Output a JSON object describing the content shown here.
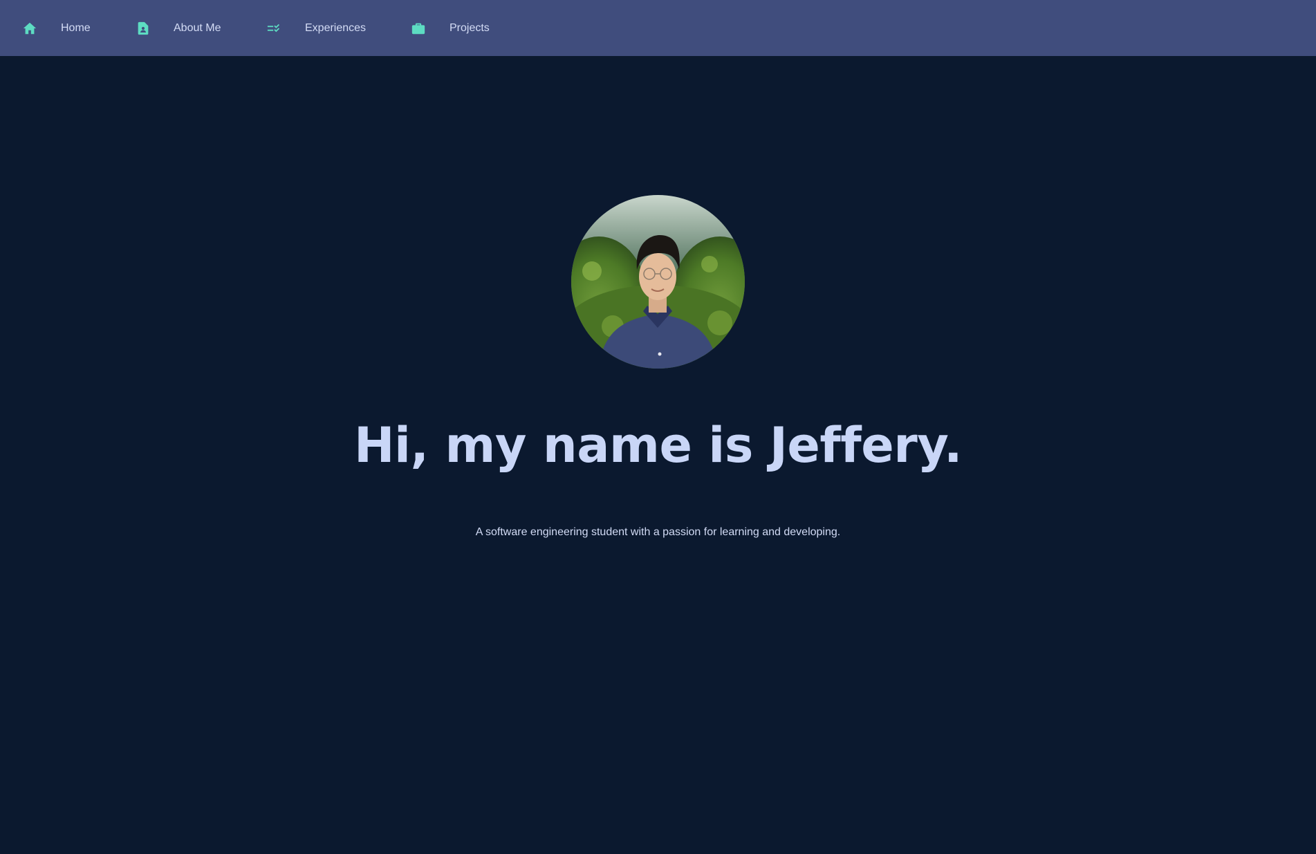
{
  "nav": {
    "items": [
      {
        "label": "Home",
        "icon": "home-icon"
      },
      {
        "label": "About Me",
        "icon": "profile-document-icon"
      },
      {
        "label": "Experiences",
        "icon": "checklist-icon"
      },
      {
        "label": "Projects",
        "icon": "briefcase-icon"
      }
    ]
  },
  "hero": {
    "title": "Hi, my name is Jeffery.",
    "subtitle": "A software engineering student with a passion for learning and developing."
  },
  "colors": {
    "nav_background": "#404d7d",
    "page_background": "#0b192f",
    "accent": "#5ddcc2",
    "title_text": "#c9d6f7"
  }
}
